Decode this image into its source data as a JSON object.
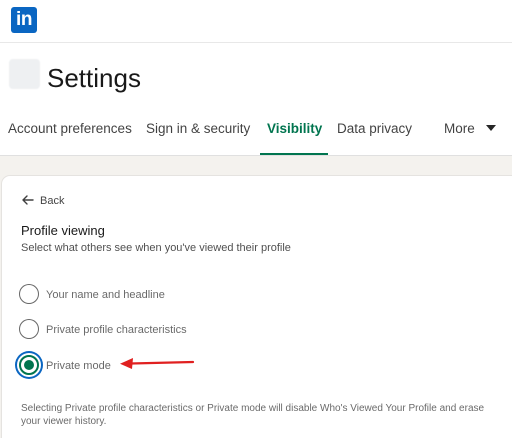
{
  "app": {
    "logo_text": "in",
    "brand_color": "#0a66c2",
    "accent_color": "#01754f",
    "arrow_color": "#e02020"
  },
  "header": {
    "title": "Settings"
  },
  "tabs": [
    {
      "label": "Account preferences",
      "active": false
    },
    {
      "label": "Sign in & security",
      "active": false
    },
    {
      "label": "Visibility",
      "active": true
    },
    {
      "label": "Data privacy",
      "active": false
    },
    {
      "label": "More",
      "active": false,
      "icon": "caret-down-icon"
    }
  ],
  "content": {
    "back_label": "Back",
    "section_title": "Profile viewing",
    "section_subtitle": "Select what others see when you've viewed their profile",
    "options": [
      {
        "label": "Your name and headline",
        "selected": false
      },
      {
        "label": "Private profile characteristics",
        "selected": false
      },
      {
        "label": "Private mode",
        "selected": true
      }
    ],
    "footnote": "Selecting Private profile characteristics or Private mode will disable Who's Viewed Your Profile and erase your viewer history."
  }
}
